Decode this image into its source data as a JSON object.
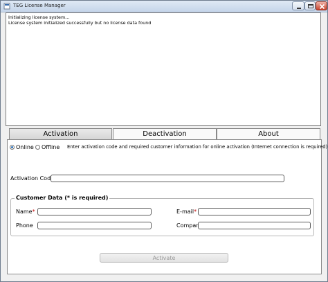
{
  "window": {
    "title": "TEG License Manager",
    "controls": [
      "minimize-icon",
      "maximize-icon",
      "close-icon"
    ]
  },
  "log": {
    "lines": [
      "Initializing license system...",
      "License system initialized successfully but no license data found"
    ]
  },
  "tabs": [
    {
      "label": "Activation",
      "selected": true
    },
    {
      "label": "Deactivation",
      "selected": false
    },
    {
      "label": "About",
      "selected": false
    }
  ],
  "activation": {
    "mode_online": "Online",
    "mode_offline": "Offline",
    "selected_mode": "Online",
    "instructions": "Enter activation code and required customer information for online activation (Internet connection is required)",
    "activation_code_label": "Activation Code",
    "activation_code_value": "",
    "customer_group_title": "Customer Data (* is required)",
    "name_label": "Name",
    "email_label": "E-mail",
    "phone_label": "Phone",
    "company_label": "Company",
    "required_marker": "*",
    "name_value": "",
    "email_value": "",
    "phone_value": "",
    "company_value": "",
    "activate_label": "Activate"
  },
  "colors": {
    "required": "#c00000",
    "radio_selected": "#2a6fb8",
    "disabled_text": "#9a9a9a"
  }
}
